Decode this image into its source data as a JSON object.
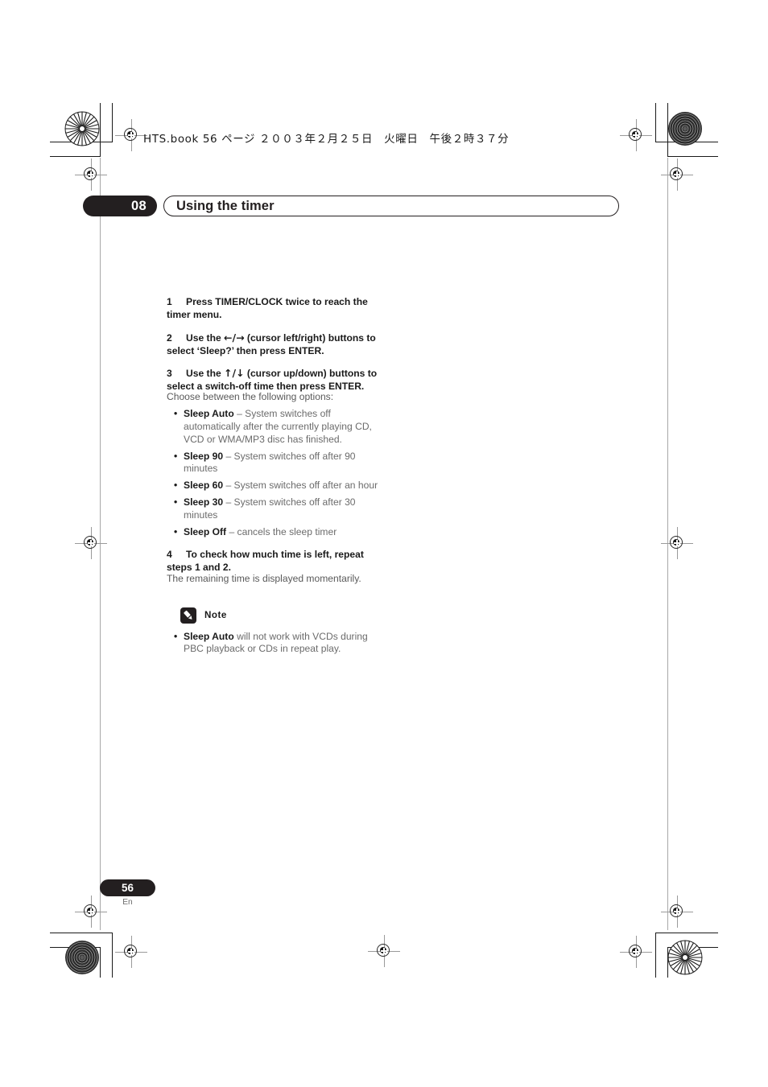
{
  "running_head": "HTS.book  56 ページ  ２００３年２月２５日　火曜日　午後２時３７分",
  "chapter": {
    "number": "08",
    "title": "Using the timer"
  },
  "steps": [
    {
      "num": "1",
      "text": "Press TIMER/CLOCK twice to reach the timer menu."
    },
    {
      "num": "2",
      "text_before": "Use the ",
      "arrows": "←/→",
      "text_after": " (cursor left/right) buttons to select ‘Sleep?’ then press ENTER."
    },
    {
      "num": "3",
      "text_before": "Use the ",
      "arrows": "↑/↓",
      "text_after": " (cursor up/down) buttons to select a switch-off time then press ENTER."
    },
    {
      "num": "4",
      "text": "To check how much time is left, repeat steps 1 and 2."
    }
  ],
  "lead_in": "Choose between the following options:",
  "options": [
    {
      "bullet": "•",
      "label": "Sleep Auto",
      "description": " – System switches off automatically after the currently playing CD, VCD or WMA/MP3 disc has finished."
    },
    {
      "bullet": "•",
      "label": "Sleep 90",
      "description": " – System switches off after 90 minutes"
    },
    {
      "bullet": "•",
      "label": "Sleep 60",
      "description": " – System switches off after an hour"
    },
    {
      "bullet": "•",
      "label": "Sleep 30",
      "description": " – System switches off after 30 minutes"
    },
    {
      "bullet": "•",
      "label": "Sleep Off",
      "description": " – cancels the sleep timer"
    }
  ],
  "step4_detail": "The remaining time is displayed momentarily.",
  "note": {
    "icon": "pencil-icon",
    "label": "Note",
    "items": [
      {
        "bullet": "•",
        "label": "Sleep Auto",
        "description": " will not work with VCDs during PBC playback or CDs in repeat play."
      }
    ]
  },
  "footer": {
    "page_number": "56",
    "language": "En"
  },
  "colors": {
    "ink": "#231f20",
    "body_gray": "#6b6b6b",
    "mark_gray": "#8c8c8c"
  }
}
